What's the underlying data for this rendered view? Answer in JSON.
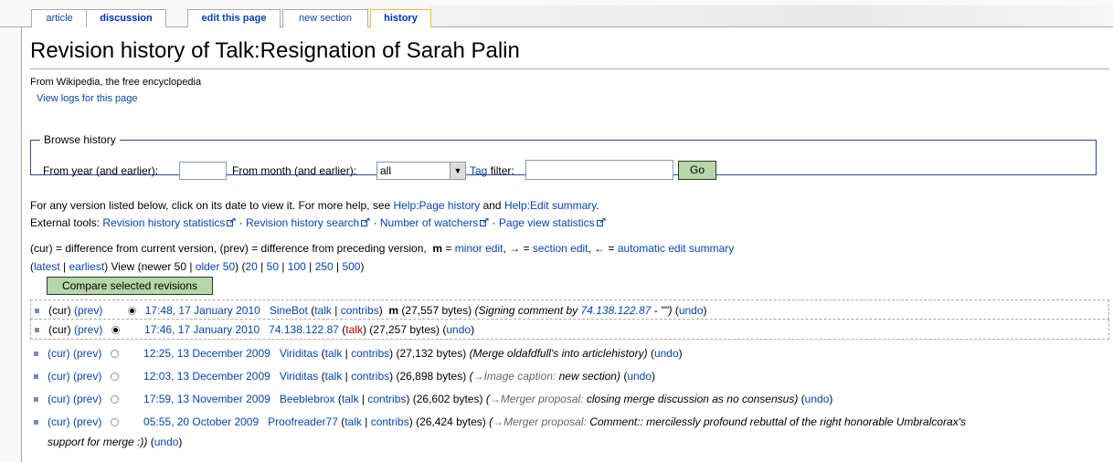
{
  "tabs": [
    {
      "label": "article"
    },
    {
      "label": "discussion"
    },
    {
      "label": "edit this page"
    },
    {
      "label": "new section"
    },
    {
      "label": "history"
    }
  ],
  "page": {
    "title": "Revision history of Talk:Resignation of Sarah Palin",
    "subtitle": "From Wikipedia, the free encyclopedia",
    "view_logs": "View logs for this page"
  },
  "browse": {
    "legend": "Browse history",
    "year_label": "From year (and earlier):",
    "month_label": "From month (and earlier):",
    "month_value": "all",
    "tag_link": "Tag",
    "tag_label": " filter:",
    "go_label": "Go"
  },
  "help": {
    "text": "For any version listed below, click on its date to view it. For more help, see ",
    "link1": "Help:Page history",
    "and": " and ",
    "link2": "Help:Edit summary",
    "period": "."
  },
  "tools": {
    "label": "External tools: ",
    "items": [
      "Revision history statistics",
      "Revision history search",
      "Number of watchers",
      "Page view statistics"
    ]
  },
  "legend_line": {
    "p1": "(cur) = difference from current version, (prev) = difference from preceding version,",
    "m": "m",
    "eq1": " = ",
    "minor": "minor edit",
    "p2": ", → = ",
    "section": "section edit",
    "p3": ", ← = ",
    "auto": "automatic edit summary"
  },
  "nav": {
    "open": "(",
    "latest": "latest",
    "sep1": " | ",
    "earliest": "earliest",
    "mid": ") View (newer 50  | ",
    "older": "older 50",
    "close": ") (",
    "n20": "20",
    "n50": "50",
    "n100": "100",
    "n250": "250",
    "n500": "500",
    "end": ")"
  },
  "compare_label": "Compare selected revisions",
  "revisions": [
    {
      "cur": "(cur)",
      "prev": "(prev)",
      "date": "17:48, 17 January 2010",
      "user": "SineBot",
      "talk": "talk",
      "contribs": "contribs",
      "minor": "m",
      "size": "(27,557 bytes)",
      "summary_pre": "(Signing comment by ",
      "summary_link": "74.138.122.87",
      "summary_post": " - \"\")",
      "undo": "undo"
    },
    {
      "cur": "(cur)",
      "prev": "(prev)",
      "date": "17:46, 17 January 2010",
      "user": "74.138.122.87",
      "talk": "talk",
      "size": "(27,257 bytes)",
      "undo": "undo"
    },
    {
      "cur": "(cur)",
      "prev": "(prev)",
      "date": "12:25, 13 December 2009",
      "user": "Viriditas",
      "talk": "talk",
      "contribs": "contribs",
      "size": "(27,132 bytes)",
      "summary": "(Merge oldafdfull's into articlehistory)",
      "undo": "undo"
    },
    {
      "cur": "(cur)",
      "prev": "(prev)",
      "date": "12:03, 13 December 2009",
      "user": "Viriditas",
      "talk": "talk",
      "contribs": "contribs",
      "size": "(26,898 bytes)",
      "section": "→Image caption:",
      "summary": " new section)",
      "undo": "undo"
    },
    {
      "cur": "(cur)",
      "prev": "(prev)",
      "date": "17:59, 13 November 2009",
      "user": "Beeblebrox",
      "talk": "talk",
      "contribs": "contribs",
      "size": "(26,602 bytes)",
      "section": "→Merger proposal:",
      "summary": " closing merge discussion as no consensus)",
      "undo": "undo"
    },
    {
      "cur": "(cur)",
      "prev": "(prev)",
      "date": "05:55, 20 October 2009",
      "user": "Proofreader77",
      "talk": "talk",
      "contribs": "contribs",
      "size": "(26,424 bytes)",
      "section": "→Merger proposal:",
      "summary": " Comment:: mercilessly profound rebuttal of the right honorable Umbralcorax's",
      "summary_line2": "support for merge :))",
      "undo": "undo"
    }
  ]
}
